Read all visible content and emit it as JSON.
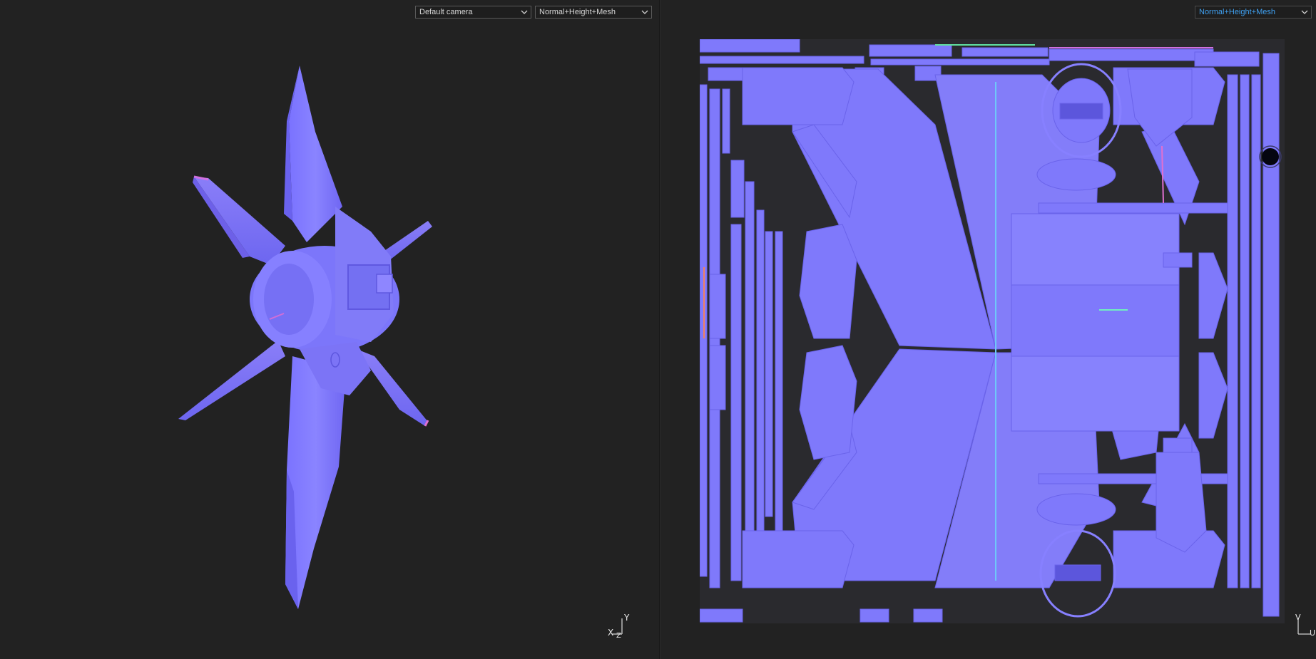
{
  "viewport_3d": {
    "camera_dropdown": {
      "value": "Default camera"
    },
    "mode_dropdown": {
      "value": "Normal+Height+Mesh"
    },
    "axis_gizmo": {
      "x": "X",
      "y": "Y",
      "z": "Z"
    }
  },
  "viewport_2d": {
    "mode_dropdown": {
      "value": "Normal+Height+Mesh"
    },
    "axis_gizmo": {
      "u": "U",
      "v": "V"
    }
  },
  "colors": {
    "background": "#222222",
    "normal_map_base": "#8080ff",
    "dropdown_active_text": "#3fa0f0"
  }
}
